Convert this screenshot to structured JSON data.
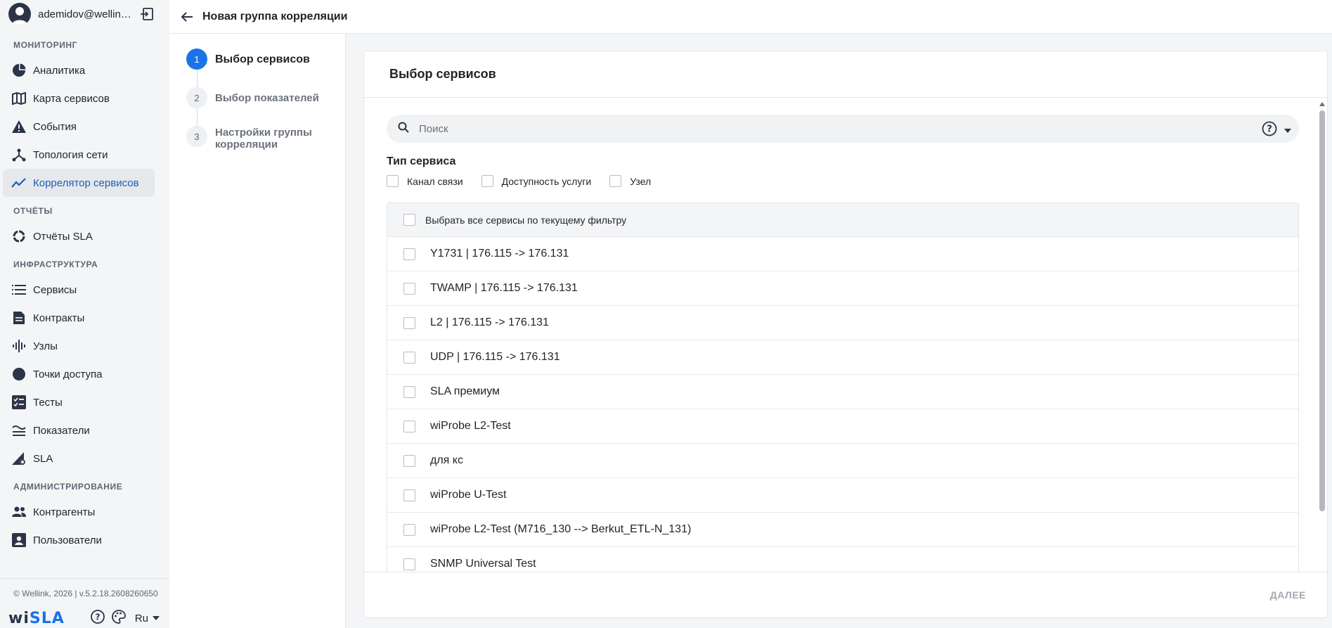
{
  "user": {
    "name": "ademidov@wellink..."
  },
  "sidebar": {
    "sections": [
      {
        "title": "МОНИТОРИНГ",
        "items": [
          {
            "label": "Аналитика",
            "icon": "pie-chart-icon"
          },
          {
            "label": "Карта сервисов",
            "icon": "map-icon"
          },
          {
            "label": "События",
            "icon": "warning-icon"
          },
          {
            "label": "Топология сети",
            "icon": "topology-icon"
          },
          {
            "label": "Коррелятор сервисов",
            "icon": "trend-icon",
            "active": true
          }
        ]
      },
      {
        "title": "ОТЧЁТЫ",
        "items": [
          {
            "label": "Отчёты SLA",
            "icon": "ring-chart-icon"
          }
        ]
      },
      {
        "title": "ИНФРАСТРУКТУРА",
        "items": [
          {
            "label": "Сервисы",
            "icon": "list-icon"
          },
          {
            "label": "Контракты",
            "icon": "document-icon"
          },
          {
            "label": "Узлы",
            "icon": "waveform-icon"
          },
          {
            "label": "Точки доступа",
            "icon": "dot-icon"
          },
          {
            "label": "Тесты",
            "icon": "checklist-icon"
          },
          {
            "label": "Показатели",
            "icon": "metrics-icon"
          },
          {
            "label": "SLA",
            "icon": "sla-gear-icon"
          }
        ]
      },
      {
        "title": "АДМИНИСТРИРОВАНИЕ",
        "items": [
          {
            "label": "Контрагенты",
            "icon": "people-icon"
          },
          {
            "label": "Пользователи",
            "icon": "user-card-icon"
          }
        ]
      }
    ],
    "copyright": "© Wellink, 2026 | v.5.2.18.2608260650",
    "brand_main": "wi",
    "brand_rest": "SLA",
    "language": "Ru"
  },
  "topbar": {
    "title": "Новая группа корреляции"
  },
  "stepper": {
    "steps": [
      {
        "num": "1",
        "label": "Выбор сервисов",
        "active": true
      },
      {
        "num": "2",
        "label": "Выбор показателей"
      },
      {
        "num": "3",
        "label": "Настройки группы корреляции"
      }
    ]
  },
  "card": {
    "title": "Выбор сервисов",
    "search": {
      "placeholder": "Поиск"
    },
    "filter": {
      "title": "Тип сервиса",
      "options": [
        "Канал связи",
        "Доступность услуги",
        "Узел"
      ]
    },
    "select_all_label": "Выбрать все сервисы по текущему фильтру",
    "services": [
      "Y1731 | 176.115 -> 176.131",
      "TWAMP | 176.115 -> 176.131",
      "L2 | 176.115 -> 176.131",
      "UDP | 176.115 -> 176.131",
      "SLA премиум",
      "wiProbe L2-Test",
      "для кс",
      "wiProbe U-Test",
      "wiProbe L2-Test (M716_130 --> Berkut_ETL-N_131)",
      "SNMP Universal Test"
    ],
    "next_label": "ДАЛЕЕ"
  },
  "colors": {
    "accent": "#1a73e8",
    "active_nav_text": "#1a5fb4",
    "sidebar_bg": "#f4f5f7"
  }
}
